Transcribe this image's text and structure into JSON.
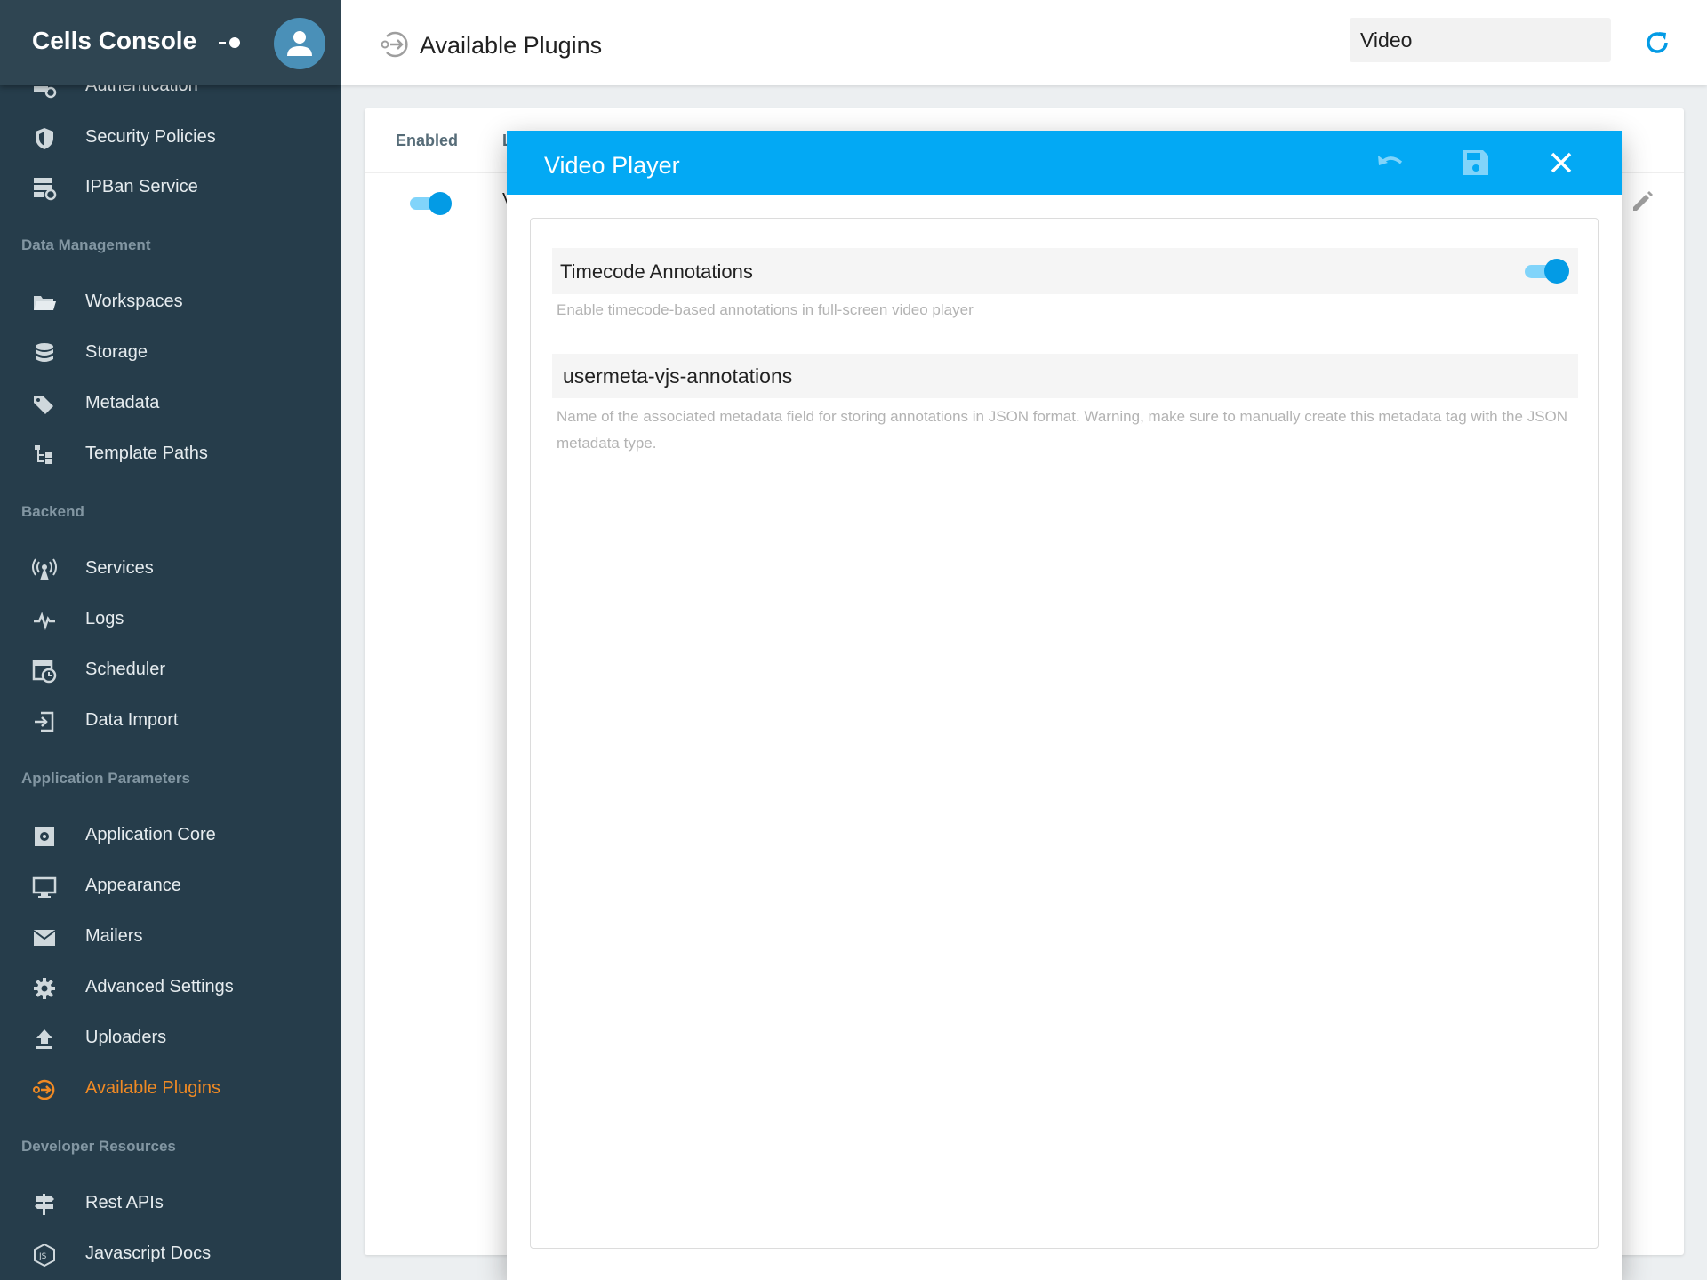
{
  "app": {
    "title": "Cells Console"
  },
  "sidebar": {
    "items_top": [
      {
        "label": "Authentication",
        "icon": "authentication-icon"
      },
      {
        "label": "Security Policies",
        "icon": "shield-icon"
      },
      {
        "label": "IPBan Service",
        "icon": "ipban-icon"
      }
    ],
    "sections": [
      {
        "title": "Data Management",
        "items": [
          {
            "label": "Workspaces",
            "icon": "folder-icon"
          },
          {
            "label": "Storage",
            "icon": "database-icon"
          },
          {
            "label": "Metadata",
            "icon": "tags-icon"
          },
          {
            "label": "Template Paths",
            "icon": "file-tree-icon"
          }
        ]
      },
      {
        "title": "Backend",
        "items": [
          {
            "label": "Services",
            "icon": "access-point-icon"
          },
          {
            "label": "Logs",
            "icon": "pulse-icon"
          },
          {
            "label": "Scheduler",
            "icon": "calendar-clock-icon"
          },
          {
            "label": "Data Import",
            "icon": "import-icon"
          }
        ]
      },
      {
        "title": "Application Parameters",
        "items": [
          {
            "label": "Application Core",
            "icon": "core-icon"
          },
          {
            "label": "Appearance",
            "icon": "monitor-icon"
          },
          {
            "label": "Mailers",
            "icon": "email-icon"
          },
          {
            "label": "Advanced Settings",
            "icon": "gear-icon"
          },
          {
            "label": "Uploaders",
            "icon": "upload-icon"
          },
          {
            "label": "Available Plugins",
            "icon": "plugin-icon",
            "active": true
          }
        ]
      },
      {
        "title": "Developer Resources",
        "items": [
          {
            "label": "Rest APIs",
            "icon": "signpost-icon"
          },
          {
            "label": "Javascript Docs",
            "icon": "js-icon"
          }
        ]
      }
    ]
  },
  "topbar": {
    "title": "Available Plugins",
    "search_value": "Video"
  },
  "table": {
    "col_enabled": "Enabled",
    "col_next": "L",
    "row_name": "V",
    "row_enabled": true
  },
  "modal": {
    "title": "Video Player",
    "toggle_field": {
      "label": "Timecode Annotations",
      "value": true,
      "help": "Enable timecode-based annotations in full-screen video player"
    },
    "text_field": {
      "value": "usermeta-vjs-annotations",
      "help": "Name of the associated metadata field for storing annotations in JSON format. Warning, make sure to manually create this metadata tag with the JSON metadata type."
    }
  },
  "colors": {
    "sidebar_bg": "#263d4b",
    "accent": "#03a9f4",
    "active": "#f08a24",
    "toggle_knob": "#039be5",
    "toggle_track": "#81d4fa"
  }
}
